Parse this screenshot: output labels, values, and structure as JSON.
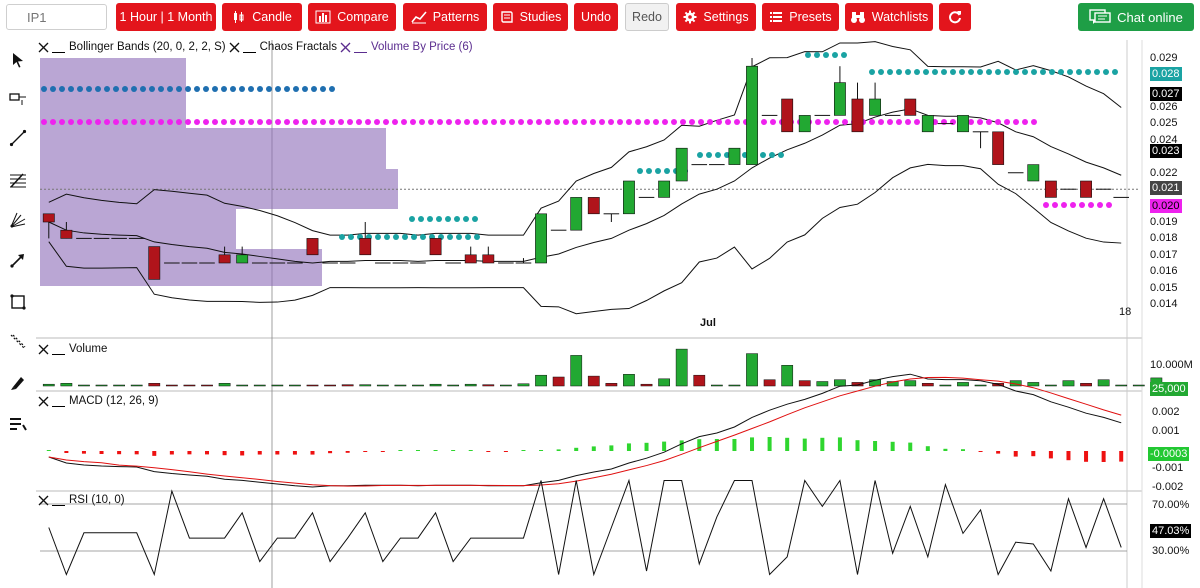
{
  "toolbar": {
    "symbol_placeholder": "IP1",
    "timeframe_label": "1 Hour | 1 Month",
    "candle_label": "Candle",
    "compare_label": "Compare",
    "patterns_label": "Patterns",
    "studies_label": "Studies",
    "undo_label": "Undo",
    "redo_label": "Redo",
    "settings_label": "Settings",
    "presets_label": "Presets",
    "watchlists_label": "Watchlists",
    "chat_label": "Chat online"
  },
  "colors": {
    "accent": "#e3151c",
    "chat": "#1e9e46",
    "up": "#22a832",
    "down": "#b0141b",
    "teal": "#1aa3a3",
    "magenta": "#ee22ee",
    "vbp": "#8c6bb8"
  },
  "tools": [
    "cursor-icon",
    "crosshair-icon",
    "line-icon",
    "fibonacci-icon",
    "gann-fan-icon",
    "arrow-icon",
    "rectangle-icon",
    "ruler-icon",
    "pencil-icon",
    "study-list-icon"
  ],
  "price_panel": {
    "legend": {
      "bollinger": "Bollinger Bands (20, 0, 2, 2, S)",
      "fractals": "Chaos Fractals",
      "vbp": "Volume By Price (6)"
    },
    "y_ticks": [
      "0.029",
      "0.027",
      "0.026",
      "0.025",
      "0.024",
      "0.023",
      "0.022",
      "0.021",
      "0.019",
      "0.018",
      "0.017",
      "0.016",
      "0.015",
      "0.014"
    ],
    "tags": {
      "upper_fractal": "0.028",
      "bb_upper": "0.027",
      "bb_mid": "0.023",
      "last": "0.021",
      "lower_fractal": "0.020"
    },
    "x_labels": {
      "month": "Jul",
      "day": "18"
    }
  },
  "volume_panel": {
    "legend": "Volume",
    "y_tick": "10.000M",
    "tag": "25,000"
  },
  "macd_panel": {
    "legend": "MACD (12, 26, 9)",
    "y_ticks": [
      "0.002",
      "0.001",
      "-0.001",
      "-0.002"
    ],
    "tag": "-0.0003"
  },
  "rsi_panel": {
    "legend": "RSI (10, 0)",
    "y_ticks": [
      "70.00%",
      "30.00%"
    ],
    "tag": "47.03%"
  },
  "chart_data": {
    "type": "candlestick",
    "candles": [
      [
        0.0195,
        0.019,
        0.019,
        0.018,
        "d"
      ],
      [
        0.0185,
        0.018,
        0.019,
        0.018,
        "d"
      ],
      [
        0.018,
        0.018,
        0.018,
        0.018,
        "n"
      ],
      [
        0.018,
        0.018,
        0.018,
        0.018,
        "n"
      ],
      [
        0.018,
        0.018,
        0.018,
        0.018,
        "n"
      ],
      [
        0.018,
        0.018,
        0.018,
        0.018,
        "n"
      ],
      [
        0.0175,
        0.0155,
        0.0175,
        0.0155,
        "d"
      ],
      [
        0.0165,
        0.0165,
        0.0165,
        0.0165,
        "n"
      ],
      [
        0.0165,
        0.0165,
        0.0165,
        0.0165,
        "n"
      ],
      [
        0.0165,
        0.0165,
        0.0165,
        0.0165,
        "n"
      ],
      [
        0.017,
        0.0165,
        0.0175,
        0.0165,
        "d"
      ],
      [
        0.0165,
        0.017,
        0.0175,
        0.0165,
        "u"
      ],
      [
        0.0165,
        0.0165,
        0.0165,
        0.0165,
        "n"
      ],
      [
        0.0165,
        0.0165,
        0.0165,
        0.0165,
        "n"
      ],
      [
        0.0165,
        0.0165,
        0.0165,
        0.0165,
        "n"
      ],
      [
        0.018,
        0.017,
        0.018,
        0.017,
        "d"
      ],
      [
        0.0165,
        0.0165,
        0.0165,
        0.0165,
        "n"
      ],
      [
        0.0165,
        0.0165,
        0.0165,
        0.0165,
        "n"
      ],
      [
        0.018,
        0.017,
        0.019,
        0.017,
        "d"
      ],
      [
        0.0165,
        0.0165,
        0.0165,
        0.0165,
        "n"
      ],
      [
        0.0165,
        0.0165,
        0.0165,
        0.0165,
        "n"
      ],
      [
        0.0165,
        0.0165,
        0.0165,
        0.0165,
        "n"
      ],
      [
        0.018,
        0.017,
        0.018,
        0.017,
        "d"
      ],
      [
        0.0165,
        0.0165,
        0.0165,
        0.0165,
        "n"
      ],
      [
        0.017,
        0.0165,
        0.0175,
        0.0165,
        "d"
      ],
      [
        0.017,
        0.0165,
        0.0175,
        0.0165,
        "d"
      ],
      [
        0.0165,
        0.0165,
        0.0165,
        0.0165,
        "n"
      ],
      [
        0.0165,
        0.0165,
        0.0168,
        0.0165,
        "n"
      ],
      [
        0.0165,
        0.0195,
        0.0195,
        0.0165,
        "u"
      ],
      [
        0.0185,
        0.0185,
        0.0185,
        0.0185,
        "n"
      ],
      [
        0.0185,
        0.0205,
        0.0205,
        0.0185,
        "u"
      ],
      [
        0.0205,
        0.0195,
        0.0205,
        0.0195,
        "d"
      ],
      [
        0.0195,
        0.0195,
        0.0195,
        0.019,
        "n"
      ],
      [
        0.0195,
        0.0215,
        0.0215,
        0.0195,
        "u"
      ],
      [
        0.0205,
        0.0205,
        0.0205,
        0.0205,
        "n"
      ],
      [
        0.0205,
        0.0215,
        0.0215,
        0.0205,
        "u"
      ],
      [
        0.0215,
        0.0235,
        0.0235,
        0.0215,
        "u"
      ],
      [
        0.0225,
        0.0225,
        0.0225,
        0.0225,
        "n"
      ],
      [
        0.0225,
        0.0225,
        0.0225,
        0.0225,
        "n"
      ],
      [
        0.0225,
        0.0235,
        0.0235,
        0.0225,
        "u"
      ],
      [
        0.0225,
        0.0285,
        0.029,
        0.0225,
        "u"
      ],
      [
        0.0255,
        0.0255,
        0.0255,
        0.0255,
        "n"
      ],
      [
        0.0265,
        0.0245,
        0.0265,
        0.0245,
        "d"
      ],
      [
        0.0245,
        0.0255,
        0.0255,
        0.0245,
        "u"
      ],
      [
        0.0255,
        0.0255,
        0.0255,
        0.0255,
        "n"
      ],
      [
        0.0255,
        0.0275,
        0.0285,
        0.0255,
        "u"
      ],
      [
        0.0265,
        0.0245,
        0.0275,
        0.0245,
        "d"
      ],
      [
        0.0255,
        0.0265,
        0.0275,
        0.0255,
        "u"
      ],
      [
        0.0255,
        0.0255,
        0.0255,
        0.0255,
        "n"
      ],
      [
        0.0265,
        0.0255,
        0.0265,
        0.0255,
        "d"
      ],
      [
        0.0255,
        0.0245,
        0.0255,
        0.0245,
        "u"
      ],
      [
        0.025,
        0.025,
        0.025,
        0.025,
        "n"
      ],
      [
        0.0255,
        0.0245,
        0.0255,
        0.0245,
        "u"
      ],
      [
        0.0245,
        0.0245,
        0.0245,
        0.0235,
        "n"
      ],
      [
        0.0245,
        0.0225,
        0.0245,
        0.0225,
        "d"
      ],
      [
        0.022,
        0.022,
        0.022,
        0.022,
        "n"
      ],
      [
        0.0225,
        0.0215,
        0.0225,
        0.0215,
        "u"
      ],
      [
        0.0215,
        0.0205,
        0.0215,
        0.0205,
        "d"
      ],
      [
        0.021,
        0.021,
        0.021,
        0.021,
        "n"
      ],
      [
        0.0215,
        0.0205,
        0.0215,
        0.0205,
        "d"
      ],
      [
        0.021,
        0.021,
        0.021,
        0.021,
        "n"
      ],
      [
        0.0205,
        0.0205,
        0.0205,
        0.0205,
        "n"
      ]
    ],
    "volumes": [
      [
        0.2,
        "u"
      ],
      [
        0.3,
        "u"
      ],
      [
        0.05,
        "n"
      ],
      [
        0.05,
        "n"
      ],
      [
        0.05,
        "n"
      ],
      [
        0.05,
        "n"
      ],
      [
        0.3,
        "d"
      ],
      [
        0.1,
        "d"
      ],
      [
        0.1,
        "d"
      ],
      [
        0.1,
        "d"
      ],
      [
        0.3,
        "u"
      ],
      [
        0.05,
        "n"
      ],
      [
        0.05,
        "n"
      ],
      [
        0.05,
        "n"
      ],
      [
        0.05,
        "n"
      ],
      [
        0.1,
        "d"
      ],
      [
        0.1,
        "d"
      ],
      [
        0.15,
        "d"
      ],
      [
        0.15,
        "u"
      ],
      [
        0.1,
        "u"
      ],
      [
        0.05,
        "n"
      ],
      [
        0.05,
        "n"
      ],
      [
        0.2,
        "u"
      ],
      [
        0.05,
        "n"
      ],
      [
        0.2,
        "u"
      ],
      [
        0.15,
        "d"
      ],
      [
        0.05,
        "n"
      ],
      [
        0.25,
        "u"
      ],
      [
        1.2,
        "u"
      ],
      [
        1.0,
        "d"
      ],
      [
        3.4,
        "u"
      ],
      [
        1.1,
        "d"
      ],
      [
        0.3,
        "d"
      ],
      [
        1.3,
        "u"
      ],
      [
        0.2,
        "d"
      ],
      [
        0.8,
        "u"
      ],
      [
        4.1,
        "u"
      ],
      [
        1.2,
        "d"
      ],
      [
        0.05,
        "n"
      ],
      [
        0.05,
        "n"
      ],
      [
        3.6,
        "u"
      ],
      [
        0.7,
        "d"
      ],
      [
        2.3,
        "u"
      ],
      [
        0.6,
        "d"
      ],
      [
        0.5,
        "u"
      ],
      [
        0.7,
        "u"
      ],
      [
        0.4,
        "d"
      ],
      [
        0.7,
        "u"
      ],
      [
        0.5,
        "u"
      ],
      [
        0.6,
        "u"
      ],
      [
        0.3,
        "d"
      ],
      [
        0.05,
        "n"
      ],
      [
        0.4,
        "u"
      ],
      [
        0.05,
        "n"
      ],
      [
        0.3,
        "d"
      ],
      [
        0.6,
        "u"
      ],
      [
        0.4,
        "u"
      ],
      [
        0.05,
        "n"
      ],
      [
        0.6,
        "u"
      ],
      [
        0.3,
        "d"
      ],
      [
        0.7,
        "u"
      ],
      [
        0.05,
        "n"
      ],
      [
        0.05,
        "n"
      ],
      [
        0.9,
        "u"
      ]
    ]
  }
}
